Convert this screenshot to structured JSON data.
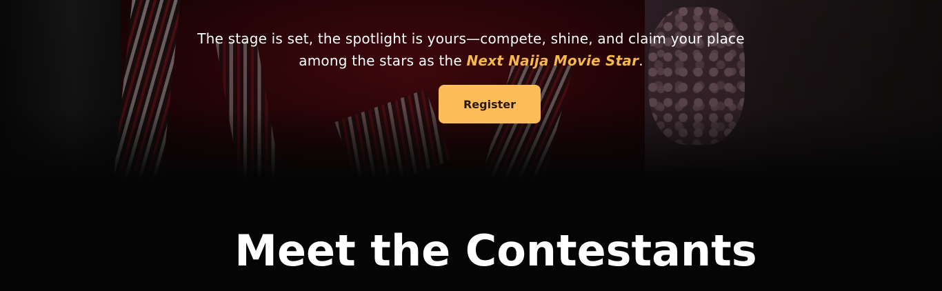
{
  "hero": {
    "text_before": "The stage is set, the spotlight is yours—compete, shine, and claim your place among the stars as the ",
    "highlight": "Next Naija Movie Star",
    "text_after": ".",
    "register_label": "Register"
  },
  "contestants": {
    "title": "Meet the Contestants"
  },
  "colors": {
    "accent": "#ffbd59",
    "highlight": "#f5b84c",
    "background": "#050505"
  }
}
